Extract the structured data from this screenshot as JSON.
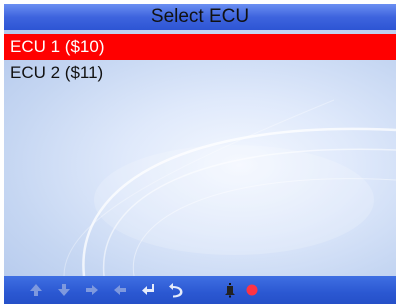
{
  "title": "Select ECU",
  "ecu_list": [
    {
      "label": "ECU  1  ($10)",
      "selected": true
    },
    {
      "label": "ECU  2  ($11)",
      "selected": false
    }
  ],
  "toolbar": {
    "icons": [
      "up-arrow-icon",
      "down-arrow-icon",
      "right-arrow-icon",
      "left-arrow-icon",
      "enter-icon",
      "back-icon",
      "bell-icon",
      "record-icon"
    ]
  },
  "colors": {
    "title_bar": "#3e64de",
    "selected_row": "#ff0000",
    "toolbar": "#2b58d2",
    "icon": "#7f99de",
    "record": "#ff3344"
  }
}
